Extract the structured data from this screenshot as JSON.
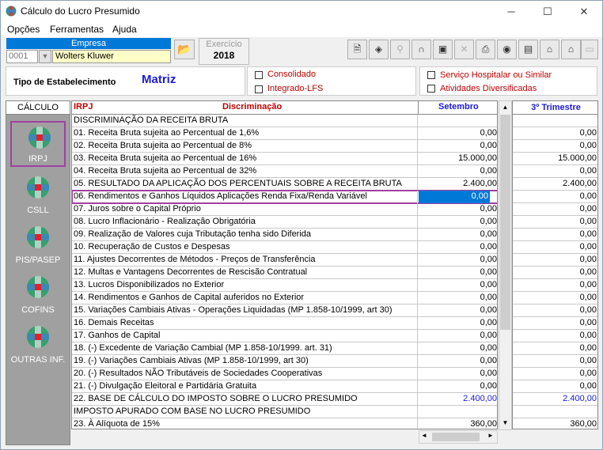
{
  "window": {
    "title": "Cálculo do Lucro Presumido"
  },
  "menu": [
    "Opções",
    "Ferramentas",
    "Ajuda"
  ],
  "company": {
    "label": "Empresa",
    "code": "0001",
    "name": "Wolters Kluwer"
  },
  "exercise": {
    "label": "Exercício",
    "year": "2018"
  },
  "toolbar": [
    "doc-icon",
    "nav-icon",
    "search-icon",
    "lock-icon",
    "save-icon",
    "delete-icon",
    "print-icon",
    "globe-icon",
    "report-icon",
    "export-icon",
    "import-icon",
    "disabled-icon"
  ],
  "establishment": {
    "label": "Tipo de Estabelecimento",
    "value": "Matriz"
  },
  "options1": [
    "Consolidado",
    "Integrado-LFS"
  ],
  "options2": [
    "Serviço Hospitalar ou Similar",
    "Atividades Diversificadas"
  ],
  "calc_panel": {
    "header": "CÁLCULO",
    "items": [
      "IRPJ",
      "CSLL",
      "PIS/PASEP",
      "COFINS",
      "OUTRAS INF."
    ]
  },
  "grid": {
    "header_left": "IRPJ",
    "header_desc": "Discriminação",
    "header_month": "Setembro",
    "header_quarter": "3º Trimestre",
    "rows": [
      {
        "desc": "DISCRIMINAÇÃO DA RECEITA BRUTA",
        "month": "",
        "quarter": "",
        "blue": false
      },
      {
        "desc": "  01. Receita Bruta sujeita ao Percentual de 1,6%",
        "month": "0,00",
        "quarter": "0,00",
        "blue": false
      },
      {
        "desc": "  02. Receita Bruta sujeita ao Percentual de 8%",
        "month": "0,00",
        "quarter": "0,00",
        "blue": false
      },
      {
        "desc": "  03. Receita Bruta sujeita ao Percentual de 16%",
        "month": "15.000,00",
        "quarter": "15.000,00",
        "blue": false
      },
      {
        "desc": "  04. Receita Bruta sujeita ao Percentual de 32%",
        "month": "0,00",
        "quarter": "0,00",
        "blue": false
      },
      {
        "desc": "05. RESULTADO DA APLICAÇÃO DOS PERCENTUAIS SOBRE A RECEITA BRUTA",
        "month": "2.400,00",
        "quarter": "2.400,00",
        "blue": false
      },
      {
        "desc": "06. Rendimentos e Ganhos Líquidos Aplicações Renda Fixa/Renda Variável",
        "month": "0,00",
        "quarter": "0,00",
        "blue": false
      },
      {
        "desc": "07. Juros sobre o Capital Próprio",
        "month": "0,00",
        "quarter": "0,00",
        "blue": false
      },
      {
        "desc": "08. Lucro Inflacionário - Realização Obrigatória",
        "month": "0,00",
        "quarter": "0,00",
        "blue": false
      },
      {
        "desc": "09. Realização de Valores cuja Tributação tenha sido Diferida",
        "month": "0,00",
        "quarter": "0,00",
        "blue": false
      },
      {
        "desc": "10. Recuperação de Custos e Despesas",
        "month": "0,00",
        "quarter": "0,00",
        "blue": false
      },
      {
        "desc": "11. Ajustes Decorrentes de Métodos - Preços de Transferência",
        "month": "0,00",
        "quarter": "0,00",
        "blue": false
      },
      {
        "desc": "12. Multas e Vantagens Decorrentes de Rescisão Contratual",
        "month": "0,00",
        "quarter": "0,00",
        "blue": false
      },
      {
        "desc": "13. Lucros Disponibilizados no Exterior",
        "month": "0,00",
        "quarter": "0,00",
        "blue": false
      },
      {
        "desc": "14. Rendimentos e Ganhos de Capital auferidos no Exterior",
        "month": "0,00",
        "quarter": "0,00",
        "blue": false
      },
      {
        "desc": "15. Variações Cambiais Ativas - Operações Liquidadas (MP 1.858-10/1999, art 30)",
        "month": "0,00",
        "quarter": "0,00",
        "blue": false
      },
      {
        "desc": "16. Demais Receitas",
        "month": "0,00",
        "quarter": "0,00",
        "blue": false
      },
      {
        "desc": "17. Ganhos de Capital",
        "month": "0,00",
        "quarter": "0,00",
        "blue": false
      },
      {
        "desc": "18. (-) Excedente de Variação Cambial (MP 1.858-10/1999. art. 31)",
        "month": "0,00",
        "quarter": "0,00",
        "blue": false
      },
      {
        "desc": "19. (-) Variações Cambiais Ativas (MP 1.858-10/1999, art 30)",
        "month": "0,00",
        "quarter": "0,00",
        "blue": false
      },
      {
        "desc": "20. (-) Resultados NÃO Tributáveis de Sociedades Cooperativas",
        "month": "0,00",
        "quarter": "0,00",
        "blue": false
      },
      {
        "desc": "21. (-) Divulgação Eleitoral e Partidária Gratuita",
        "month": "0,00",
        "quarter": "0,00",
        "blue": false
      },
      {
        "desc": "22. BASE DE CÁLCULO DO IMPOSTO SOBRE O LUCRO PRESUMIDO",
        "month": "2.400,00",
        "quarter": "2.400,00",
        "blue": true
      },
      {
        "desc": "IMPOSTO APURADO COM BASE NO LUCRO PRESUMIDO",
        "month": "",
        "quarter": "",
        "blue": false
      },
      {
        "desc": "  23. À Alíquota de 15%",
        "month": "360,00",
        "quarter": "360,00",
        "blue": false
      }
    ]
  },
  "colors": {
    "accent": "#0078d7",
    "red": "#c00000",
    "blue": "#1a1ae0",
    "highlight": "#a040a0"
  }
}
